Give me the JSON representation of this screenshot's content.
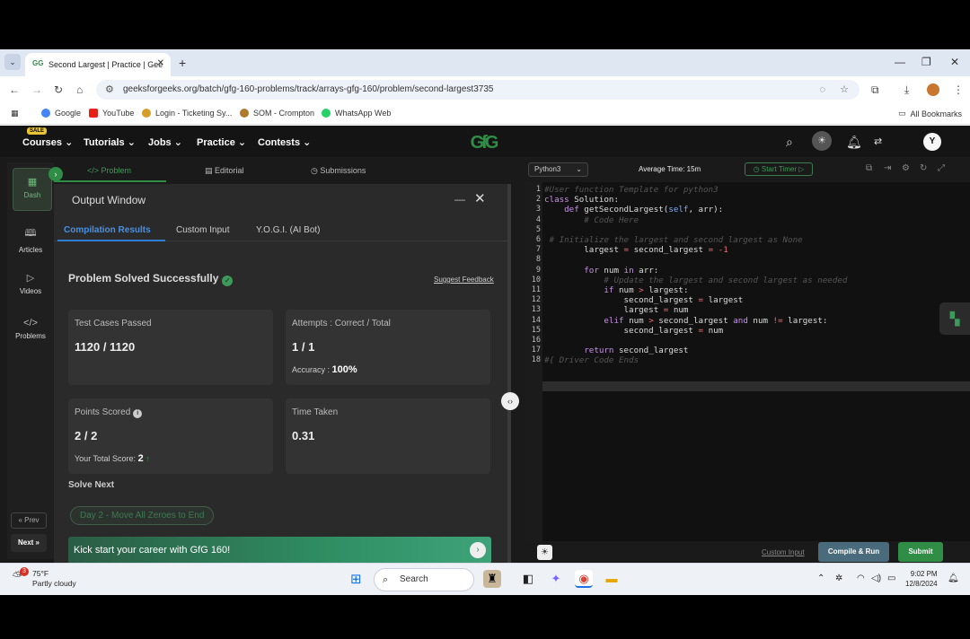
{
  "browser": {
    "tab_title": "Second Largest | Practice | Gee",
    "url": "geeksforgeeks.org/batch/gfg-160-problems/track/arrays-gfg-160/problem/second-largest3735",
    "bookmarks": [
      "Google",
      "YouTube",
      "Login - Ticketing Sy...",
      "SOM - Crompton",
      "WhatsApp Web"
    ],
    "all_bookmarks": "All Bookmarks"
  },
  "gfg_nav": {
    "sale_badge": "SALE",
    "items": [
      "Courses",
      "Tutorials",
      "Jobs",
      "Practice",
      "Contests"
    ],
    "logo": "GfG",
    "avatar_letter": "Y"
  },
  "sidebar": {
    "items": [
      "Dash",
      "Articles",
      "Videos",
      "Problems"
    ],
    "prev": "« Prev",
    "next": "Next »"
  },
  "problem_tabs": [
    "Problem",
    "Editorial",
    "Submissions"
  ],
  "output": {
    "title": "Output Window",
    "tabs": [
      "Compilation Results",
      "Custom Input",
      "Y.O.G.I. (AI Bot)"
    ],
    "status": "Problem Solved Successfully",
    "suggest_feedback": "Suggest Feedback",
    "cards": {
      "test_cases": {
        "label": "Test Cases Passed",
        "value": "1120 / 1120"
      },
      "attempts": {
        "label": "Attempts : Correct / Total",
        "value": "1 / 1",
        "accuracy_label": "Accuracy :",
        "accuracy": "100%"
      },
      "points": {
        "label": "Points Scored",
        "value": "2 / 2",
        "total_label": "Your Total Score:",
        "total": "2"
      },
      "time": {
        "label": "Time Taken",
        "value": "0.31"
      }
    },
    "solve_next": "Solve Next",
    "next_problem": "Day 2 - Move All Zeroes to End",
    "banner": "Kick start your career with GfG 160!"
  },
  "editor": {
    "language": "Python3",
    "average_time": "Average Time: 15m",
    "start_timer": "Start Timer",
    "custom_input": "Custom Input",
    "compile_run": "Compile & Run",
    "submit": "Submit",
    "line_numbers": [
      "1",
      "2",
      "3",
      "4",
      "5",
      "6",
      "7",
      "8",
      "9",
      "10",
      "11",
      "12",
      "13",
      "14",
      "15",
      "16",
      "17",
      "18"
    ],
    "lines": [
      "#User function Template for python3",
      "class Solution:",
      "    def getSecondLargest(self, arr):",
      "        # Code Here",
      "",
      " # Initialize the largest and second largest as None",
      "        largest = second_largest = -1",
      "",
      "        for num in arr:",
      "            # Update the largest and second largest as needed",
      "            if num > largest:",
      "                second_largest = largest",
      "                largest = num",
      "            elif num > second_largest and num != largest:",
      "                second_largest = num",
      "",
      "        return second_largest",
      "#{ Driver Code Ends"
    ]
  },
  "taskbar": {
    "temp": "75°F",
    "weather": "Partly cloudy",
    "notif_count": "3",
    "search": "Search",
    "time": "9:02 PM",
    "date": "12/8/2024"
  }
}
